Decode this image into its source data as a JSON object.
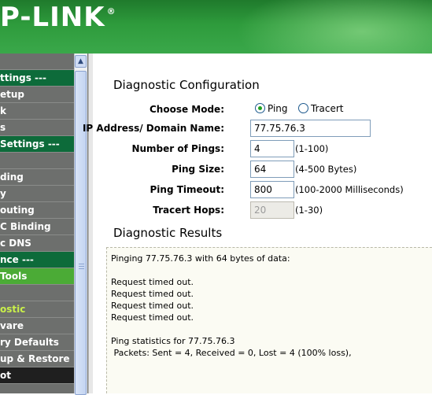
{
  "header": {
    "logo_text": "P-LINK",
    "logo_mark": "®"
  },
  "sidebar": {
    "items": [
      {
        "label": "",
        "style": "plain"
      },
      {
        "label": "ttings ---",
        "style": "group"
      },
      {
        "label": "etup",
        "style": "plain"
      },
      {
        "label": "k",
        "style": "plain"
      },
      {
        "label": "s",
        "style": "plain"
      },
      {
        "label": " Settings ---",
        "style": "group"
      },
      {
        "label": "",
        "style": "plain"
      },
      {
        "label": "ding",
        "style": "plain"
      },
      {
        "label": "y",
        "style": "plain"
      },
      {
        "label": "outing",
        "style": "plain"
      },
      {
        "label": "C Binding",
        "style": "plain"
      },
      {
        "label": "c DNS",
        "style": "plain"
      },
      {
        "label": "nce ---",
        "style": "group"
      },
      {
        "label": " Tools",
        "style": "sel"
      },
      {
        "label": "",
        "style": "plain"
      },
      {
        "label": "ostic",
        "style": "active"
      },
      {
        "label": "vare",
        "style": "plain"
      },
      {
        "label": "ry Defaults",
        "style": "plain"
      },
      {
        "label": "up & Restore",
        "style": "plain"
      },
      {
        "label": "ot",
        "style": "dark"
      }
    ],
    "scroll_up_icon": "chevron-up-icon"
  },
  "diag_config": {
    "title": "Diagnostic Configuration",
    "mode_label": "Choose Mode:",
    "mode_ping": "Ping",
    "mode_tracert": "Tracert",
    "selected_mode": "Ping",
    "ip_label": "IP Address/ Domain Name:",
    "ip_value": "77.75.76.3",
    "pings_label": "Number of Pings:",
    "pings_value": "4",
    "pings_hint": "(1-100)",
    "size_label": "Ping Size:",
    "size_value": "64",
    "size_hint": "(4-500 Bytes)",
    "timeout_label": "Ping Timeout:",
    "timeout_value": "800",
    "timeout_hint": "(100-2000 Milliseconds)",
    "hops_label": "Tracert Hops:",
    "hops_value": "20",
    "hops_hint": "(1-30)"
  },
  "diag_results": {
    "title": "Diagnostic Results",
    "lines": [
      "Pinging 77.75.76.3 with 64 bytes of data:",
      "",
      "Request timed out.",
      "Request timed out.",
      "Request timed out.",
      "Request timed out.",
      "",
      "Ping statistics for 77.75.76.3",
      " Packets: Sent = 4, Received = 0, Lost = 4 (100% loss),"
    ]
  }
}
